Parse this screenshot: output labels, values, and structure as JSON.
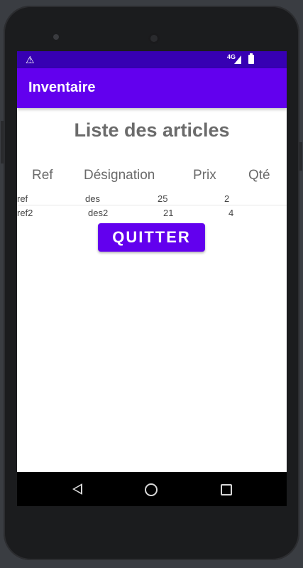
{
  "app": {
    "title": "Inventaire"
  },
  "status_bar": {
    "network_label": "4G"
  },
  "page": {
    "title": "Liste des articles"
  },
  "table": {
    "headers": [
      "Ref",
      "Désignation",
      "Prix",
      "Qté"
    ],
    "rows": [
      [
        "ref",
        "des",
        "25",
        "2"
      ],
      [
        "ref2",
        "des2",
        "21",
        "4"
      ]
    ]
  },
  "actions": {
    "quit_label": "QUITTER"
  },
  "icons": {
    "status_left": "warning-icon",
    "nav": [
      "back-icon",
      "home-icon",
      "recents-icon"
    ]
  },
  "colors": {
    "primary": "#6200ee",
    "primary_dark": "#3700b3"
  }
}
